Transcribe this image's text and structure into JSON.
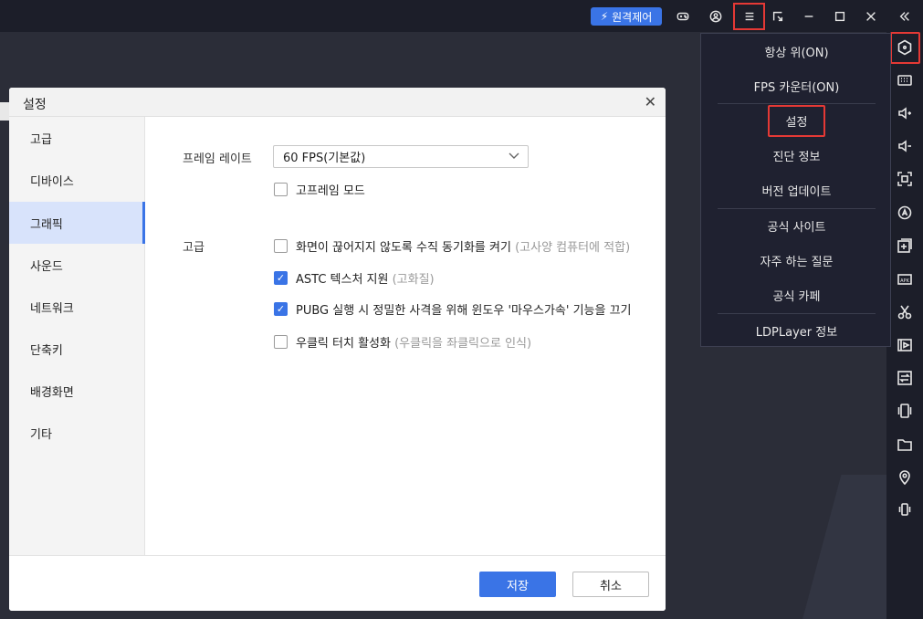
{
  "topbar": {
    "remote_label": "원격제어",
    "icons": [
      "gamepad-icon",
      "user-icon",
      "menu-icon",
      "resize-icon",
      "minimize-icon",
      "maximize-icon",
      "close-icon",
      "collapse-icon"
    ]
  },
  "menu": {
    "items": [
      {
        "label": "항상 위(ON)"
      },
      {
        "label": "FPS 카운터(ON)"
      },
      {
        "label": "설정"
      },
      {
        "label": "진단 정보"
      },
      {
        "label": "버전 업데이트"
      },
      {
        "label": "공식 사이트"
      },
      {
        "label": "자주 하는 질문"
      },
      {
        "label": "공식 카페"
      },
      {
        "label": "LDPLayer 정보"
      }
    ]
  },
  "dialog": {
    "title": "설정",
    "nav": [
      {
        "label": "고급"
      },
      {
        "label": "디바이스"
      },
      {
        "label": "그래픽"
      },
      {
        "label": "사운드"
      },
      {
        "label": "네트워크"
      },
      {
        "label": "단축키"
      },
      {
        "label": "배경화면"
      },
      {
        "label": "기타"
      }
    ],
    "active_nav": "그래픽",
    "frame_rate_label": "프레임 레이트",
    "frame_rate_value": "60 FPS(기본값)",
    "high_frame_label": "고프레임 모드",
    "advanced_label": "고급",
    "options": [
      {
        "text": "화면이 끊어지지 않도록 수직 동기화를 켜기",
        "hint": "(고사양 컴퓨터에 적합)",
        "checked": false
      },
      {
        "text": "ASTC 텍스처 지원",
        "hint": "(고화질)",
        "checked": true
      },
      {
        "text": "PUBG 실행 시 정밀한 사격을 위해 윈도우 '마우스가속' 기능을 끄기",
        "hint": "",
        "checked": true
      },
      {
        "text": "우클릭 터치 활성화",
        "hint": "(우클릭을 좌클릭으로 인식)",
        "checked": false
      }
    ],
    "save_label": "저장",
    "cancel_label": "취소"
  },
  "colors": {
    "accent": "#3a74e6",
    "highlight_red": "#e53935",
    "dark_bg": "#1c1e29"
  }
}
